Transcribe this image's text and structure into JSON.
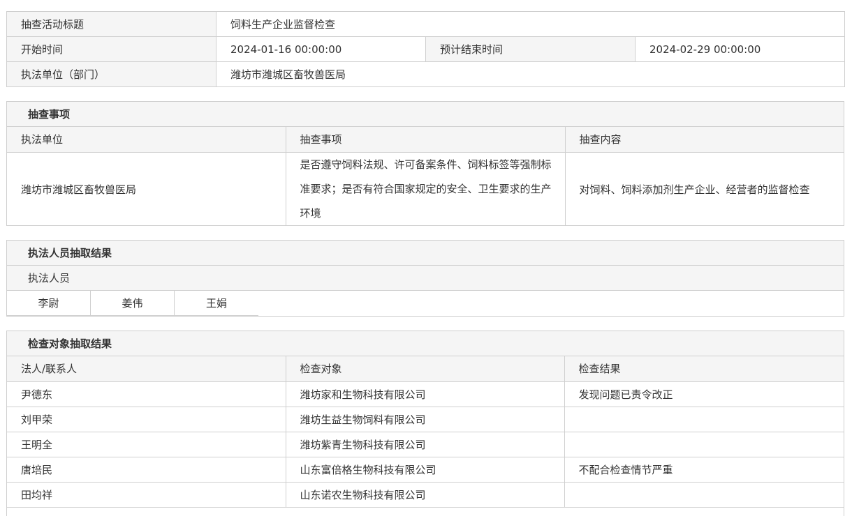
{
  "info": {
    "title_label": "抽查活动标题",
    "title_value": "饲料生产企业监督检查",
    "start_label": "开始时间",
    "start_value": "2024-01-16 00:00:00",
    "end_label": "预计结束时间",
    "end_value": "2024-02-29 00:00:00",
    "unit_label": "执法单位（部门）",
    "unit_value": "潍坊市潍城区畜牧兽医局"
  },
  "items": {
    "title": "抽查事项",
    "headers": [
      "执法单位",
      "抽查事项",
      "抽查内容"
    ],
    "row": {
      "unit": "潍坊市潍城区畜牧兽医局",
      "matter": "是否遵守饲料法规、许可备案条件、饲料标签等强制标准要求；是否有符合国家规定的安全、卫生要求的生产环境",
      "content": "对饲料、饲料添加剂生产企业、经营者的监督检查"
    }
  },
  "staff": {
    "title": "执法人员抽取结果",
    "subheader": "执法人员",
    "names": [
      "李尉",
      "姜伟",
      "王娟"
    ]
  },
  "targets": {
    "title": "检查对象抽取结果",
    "headers": [
      "法人/联系人",
      "检查对象",
      "检查结果"
    ],
    "rows": [
      {
        "person": "尹德东",
        "object": "潍坊家和生物科技有限公司",
        "result": "发现问题已责令改正"
      },
      {
        "person": "刘甲荣",
        "object": "潍坊生益生物饲料有限公司",
        "result": ""
      },
      {
        "person": "王明全",
        "object": "潍坊紫青生物科技有限公司",
        "result": ""
      },
      {
        "person": "唐培民",
        "object": "山东富倍格生物科技有限公司",
        "result": "不配合检查情节严重"
      },
      {
        "person": "田均祥",
        "object": "山东诺农生物科技有限公司",
        "result": ""
      }
    ]
  }
}
